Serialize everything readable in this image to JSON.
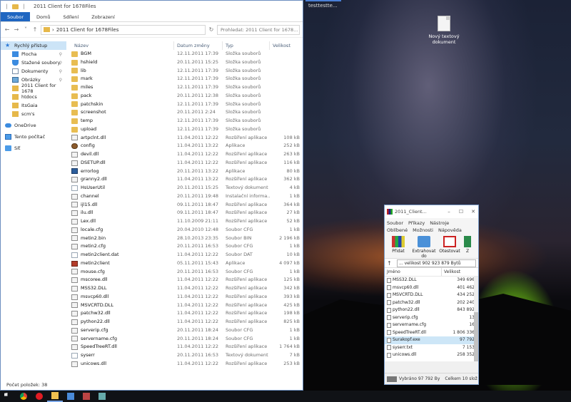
{
  "desktop": {
    "icon_label": "Nový textový dokument",
    "background_window_title": "testtestte..."
  },
  "explorer": {
    "title": "2011 Client for 1678Files",
    "title_icons": [
      "back-icon",
      "folder-icon",
      "separator"
    ],
    "tabs": [
      "Soubor",
      "Domů",
      "Sdílení",
      "Zobrazení"
    ],
    "address": "2011 Client for 1678Files",
    "search_placeholder": "Prohledat: 2011 Client for 1678...",
    "sidebar": [
      {
        "label": "Rychlý přístup",
        "icon": "star-icon",
        "active": true,
        "sub": false
      },
      {
        "label": "Plocha",
        "icon": "desktop-icon",
        "pin": true,
        "sub": true
      },
      {
        "label": "Stažené soubory",
        "icon": "download-icon",
        "pin": true,
        "sub": true
      },
      {
        "label": "Dokumenty",
        "icon": "document-icon",
        "pin": true,
        "sub": true
      },
      {
        "label": "Obrázky",
        "icon": "pictures-icon",
        "pin": true,
        "sub": true
      },
      {
        "label": "2011 Client for 1678",
        "icon": "folder-icon",
        "sub": true
      },
      {
        "label": "htdocs",
        "icon": "folder-icon",
        "sub": true
      },
      {
        "label": "ItsGaia",
        "icon": "folder-icon",
        "sub": true
      },
      {
        "label": "scm's",
        "icon": "folder-icon",
        "sub": true
      },
      {
        "label": "OneDrive",
        "icon": "cloud-icon",
        "sub": false,
        "gap": true
      },
      {
        "label": "Tento počítač",
        "icon": "computer-icon",
        "sub": false,
        "gap": true
      },
      {
        "label": "Síť",
        "icon": "network-icon",
        "sub": false,
        "gap": true
      }
    ],
    "columns": {
      "name": "Název",
      "date": "Datum změny",
      "type": "Typ",
      "size": "Velikost"
    },
    "files": [
      {
        "name": "BGM",
        "date": "12.11.2011 17:39",
        "type": "Složka souborů",
        "size": "",
        "icon": "folder"
      },
      {
        "name": "hshield",
        "date": "20.11.2011 15:25",
        "type": "Složka souborů",
        "size": "",
        "icon": "folder"
      },
      {
        "name": "lib",
        "date": "12.11.2011 17:39",
        "type": "Složka souborů",
        "size": "",
        "icon": "folder"
      },
      {
        "name": "mark",
        "date": "12.11.2011 17:39",
        "type": "Složka souborů",
        "size": "",
        "icon": "folder"
      },
      {
        "name": "miles",
        "date": "12.11.2011 17:39",
        "type": "Složka souborů",
        "size": "",
        "icon": "folder"
      },
      {
        "name": "pack",
        "date": "20.11.2011 12:38",
        "type": "Složka souborů",
        "size": "",
        "icon": "folder"
      },
      {
        "name": "patchskin",
        "date": "12.11.2011 17:39",
        "type": "Složka souborů",
        "size": "",
        "icon": "folder"
      },
      {
        "name": "screenshot",
        "date": "20.11.2011 2:24",
        "type": "Složka souborů",
        "size": "",
        "icon": "folder"
      },
      {
        "name": "temp",
        "date": "12.11.2011 17:39",
        "type": "Složka souborů",
        "size": "",
        "icon": "folder"
      },
      {
        "name": "upload",
        "date": "12.11.2011 17:39",
        "type": "Složka souborů",
        "size": "",
        "icon": "folder"
      },
      {
        "name": "artpclnt.dll",
        "date": "11.04.2011 12:22",
        "type": "Rozšíření aplikace",
        "size": "108 kB",
        "icon": "dll"
      },
      {
        "name": "config",
        "date": "11.04.2011 13:22",
        "type": "Aplikace",
        "size": "252 kB",
        "icon": "gear"
      },
      {
        "name": "devil.dll",
        "date": "11.04.2011 12:22",
        "type": "Rozšíření aplikace",
        "size": "263 kB",
        "icon": "dll"
      },
      {
        "name": "DSETUP.dll",
        "date": "11.04.2011 12:22",
        "type": "Rozšíření aplikace",
        "size": "116 kB",
        "icon": "dll"
      },
      {
        "name": "errorlog",
        "date": "20.11.2011 13:22",
        "type": "Aplikace",
        "size": "80 kB",
        "icon": "exe"
      },
      {
        "name": "granny2.dll",
        "date": "11.04.2011 13:22",
        "type": "Rozšíření aplikace",
        "size": "362 kB",
        "icon": "dll"
      },
      {
        "name": "HsUserUtil",
        "date": "20.11.2011 15:25",
        "type": "Textový dokument",
        "size": "4 kB",
        "icon": "txt"
      },
      {
        "name": "channel",
        "date": "20.11.2011 19:48",
        "type": "Instalační informa...",
        "size": "1 kB",
        "icon": "cfg"
      },
      {
        "name": "ijl15.dll",
        "date": "09.11.2011 18:47",
        "type": "Rozšíření aplikace",
        "size": "364 kB",
        "icon": "dll"
      },
      {
        "name": "ilu.dll",
        "date": "09.11.2011 18:47",
        "type": "Rozšíření aplikace",
        "size": "27 kB",
        "icon": "dll"
      },
      {
        "name": "Lex.dll",
        "date": "11.10.2009 21:11",
        "type": "Rozšíření aplikace",
        "size": "52 kB",
        "icon": "dll"
      },
      {
        "name": "locale.cfg",
        "date": "20.04.2010 12:48",
        "type": "Soubor CFG",
        "size": "1 kB",
        "icon": "cfg"
      },
      {
        "name": "metin2.bin",
        "date": "28.10.2013 23:35",
        "type": "Soubor BIN",
        "size": "2 196 kB",
        "icon": "bin"
      },
      {
        "name": "metin2.cfg",
        "date": "20.11.2011 16:53",
        "type": "Soubor CFG",
        "size": "1 kB",
        "icon": "cfg"
      },
      {
        "name": "metin2client.dat",
        "date": "11.04.2011 12:22",
        "type": "Soubor DAT",
        "size": "10 kB",
        "icon": "file"
      },
      {
        "name": "metin2client",
        "date": "05.11.2011 15:43",
        "type": "Aplikace",
        "size": "4 097 kB",
        "icon": "red"
      },
      {
        "name": "mouse.cfg",
        "date": "20.11.2011 16:53",
        "type": "Soubor CFG",
        "size": "1 kB",
        "icon": "cfg"
      },
      {
        "name": "mscoree.dll",
        "date": "11.04.2011 12:22",
        "type": "Rozšíření aplikace",
        "size": "125 kB",
        "icon": "dll"
      },
      {
        "name": "MSS32.DLL",
        "date": "11.04.2011 12:22",
        "type": "Rozšíření aplikace",
        "size": "342 kB",
        "icon": "dll"
      },
      {
        "name": "msvcp60.dll",
        "date": "11.04.2011 12:22",
        "type": "Rozšíření aplikace",
        "size": "393 kB",
        "icon": "dll"
      },
      {
        "name": "MSVCRTD.DLL",
        "date": "11.04.2011 12:22",
        "type": "Rozšíření aplikace",
        "size": "425 kB",
        "icon": "dll"
      },
      {
        "name": "patchw32.dll",
        "date": "11.04.2011 12:22",
        "type": "Rozšíření aplikace",
        "size": "198 kB",
        "icon": "dll"
      },
      {
        "name": "python22.dll",
        "date": "11.04.2011 12:22",
        "type": "Rozšíření aplikace",
        "size": "825 kB",
        "icon": "dll"
      },
      {
        "name": "serverip.cfg",
        "date": "20.11.2011 18:24",
        "type": "Soubor CFG",
        "size": "1 kB",
        "icon": "cfg"
      },
      {
        "name": "servername.cfg",
        "date": "20.11.2011 18:24",
        "type": "Soubor CFG",
        "size": "1 kB",
        "icon": "cfg"
      },
      {
        "name": "SpeedTreeRT.dll",
        "date": "11.04.2011 12:22",
        "type": "Rozšíření aplikace",
        "size": "1 764 kB",
        "icon": "dll"
      },
      {
        "name": "syserr",
        "date": "20.11.2011 16:53",
        "type": "Textový dokument",
        "size": "7 kB",
        "icon": "txt"
      },
      {
        "name": "unicows.dll",
        "date": "11.04.2011 12:22",
        "type": "Rozšíření aplikace",
        "size": "253 kB",
        "icon": "dll"
      }
    ],
    "status": "Počet položek: 38"
  },
  "rar": {
    "title": "2011_Client...",
    "controls": [
      "–",
      "☐",
      "✕"
    ],
    "menu": [
      "Soubor",
      "Příkazy",
      "Nástroje",
      "Oblíbené",
      "Možnosti",
      "Nápověda"
    ],
    "tools": [
      "Přidat",
      "Extrahovat do",
      "Otestovat",
      "Z"
    ],
    "path": "... velikost 902 923 879 Bytů",
    "col_name": "Jméno",
    "col_size": "Velikost",
    "items": [
      {
        "name": "MSS32.DLL",
        "size": "349 696"
      },
      {
        "name": "msvcp60.dll",
        "size": "401 462"
      },
      {
        "name": "MSVCRTD.DLL",
        "size": "434 252"
      },
      {
        "name": "patchw32.dll",
        "size": "202 240"
      },
      {
        "name": "python22.dll",
        "size": "843 892"
      },
      {
        "name": "serverip.cfg",
        "size": "13"
      },
      {
        "name": "servername.cfg",
        "size": "16"
      },
      {
        "name": "SpeedTreeRT.dll",
        "size": "1 806 336"
      },
      {
        "name": "Surakopf.exe",
        "size": "97 792",
        "selected": true
      },
      {
        "name": "syserr.txt",
        "size": "7 153"
      },
      {
        "name": "unicows.dll",
        "size": "258 352"
      }
    ],
    "status_left": "Vybráno 97 792 By",
    "status_right": "Celkem 10 slož"
  },
  "taskbar": [
    "start-icon",
    "chrome-icon",
    "opera-icon",
    "explorer-icon",
    "app-icon",
    "app-icon",
    "app-icon"
  ]
}
